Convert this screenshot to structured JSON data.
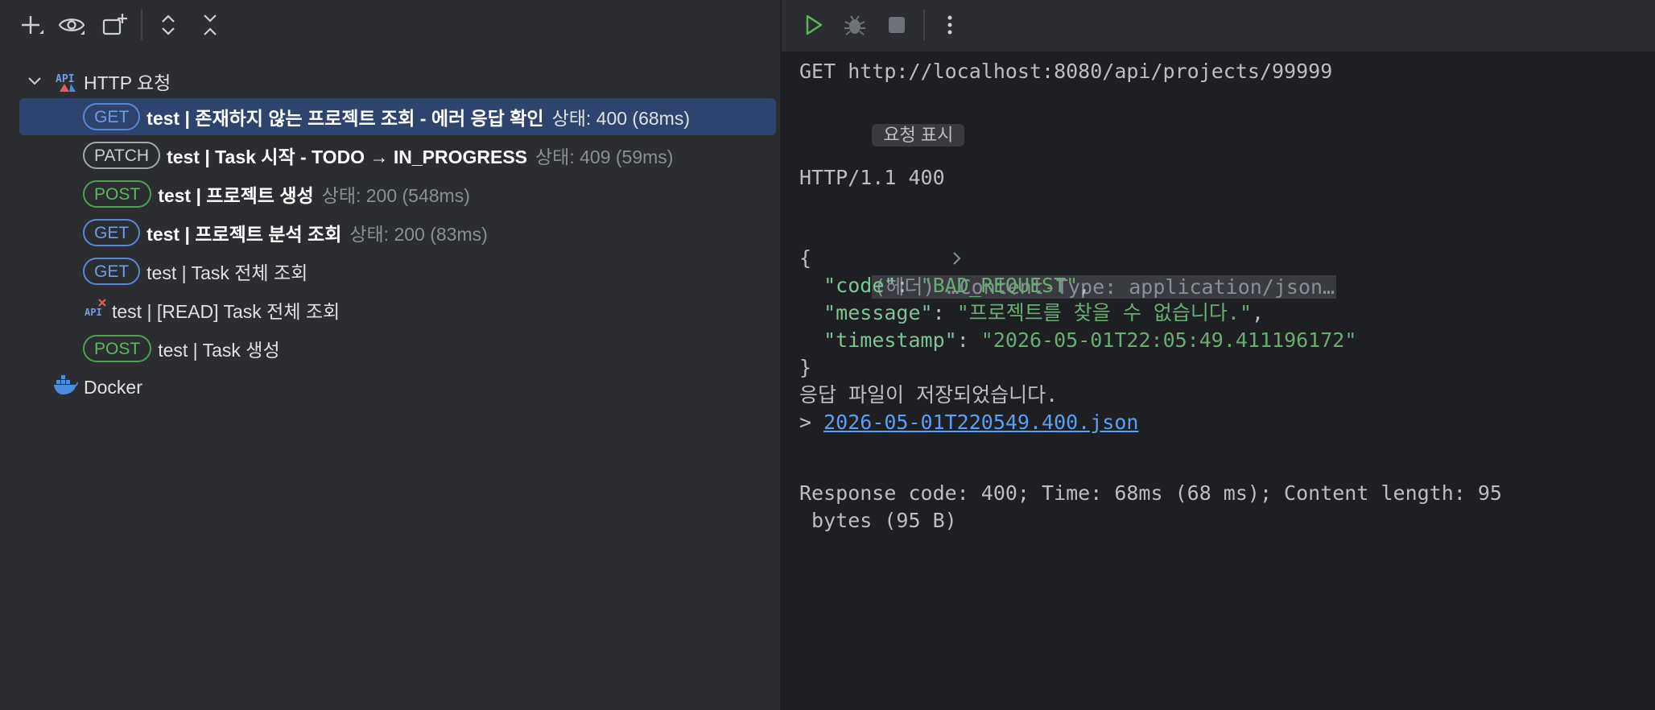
{
  "left_toolbar": {
    "icons": [
      "plus-icon",
      "eye-icon",
      "new-folder-icon",
      "expand-all-icon",
      "collapse-all-icon"
    ]
  },
  "tree": {
    "root": {
      "label": "HTTP 요청"
    },
    "items": [
      {
        "method": "GET",
        "name": "test  |  존재하지 않는 프로젝트 조회 - 에러 응답 확인",
        "status": "상태: 400 (68ms)",
        "selected": true
      },
      {
        "method": "PATCH",
        "name": "test  |  Task 시작 - TODO → IN_PROGRESS",
        "status": "상태: 409 (59ms)"
      },
      {
        "method": "POST",
        "name": "test  |  프로젝트 생성",
        "status": "상태: 200 (548ms)"
      },
      {
        "method": "GET",
        "name": "test  |  프로젝트 분석 조회",
        "status": "상태: 200 (83ms)"
      },
      {
        "method": "GET",
        "name": "test  |  Task 전체 조회",
        "status": ""
      },
      {
        "method": "",
        "name": "test | [READ] Task 전체 조회",
        "status": ""
      },
      {
        "method": "POST",
        "name": "test  |  Task 생성",
        "status": ""
      }
    ],
    "docker": {
      "label": "Docker"
    }
  },
  "right_toolbar": {
    "icons": [
      "run-icon",
      "debug-icon",
      "stop-icon",
      "more-vertical-icon"
    ]
  },
  "response": {
    "request_line": "GET http://localhost:8080/api/projects/99999",
    "show_request_chip": "요청 표시",
    "status_line": "HTTP/1.1 400",
    "headers_collapsed": "(헤더) …Content-Type: application/json…",
    "json_open": "{",
    "json": [
      {
        "key": "\"code\"",
        "value": "\"BAD_REQUEST\"",
        "suffix": ","
      },
      {
        "key": "\"message\"",
        "value": "\"프로젝트를 찾을 수 없습니다.\"",
        "suffix": ","
      },
      {
        "key": "\"timestamp\"",
        "value": "\"2026-05-01T22:05:49.411196172\"",
        "suffix": ""
      }
    ],
    "json_close": "}",
    "saved_msg": "응답 파일이 저장되었습니다.",
    "file_prefix": "> ",
    "file_link": "2026-05-01T220549.400.json",
    "summary_1": "Response code: 400; Time: 68ms (68 ms); Content length: 95",
    "summary_2": " bytes (95 B)"
  },
  "colors": {
    "selection": "#2e436e",
    "get_badge": "#5a86d8",
    "post_badge": "#4f9f52",
    "json_string": "#6aab73",
    "link": "#5a9ff5"
  }
}
